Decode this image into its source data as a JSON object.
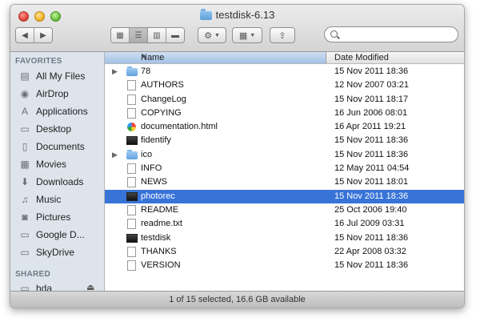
{
  "window": {
    "title": "testdisk-6.13",
    "title_icon": "folder-icon"
  },
  "toolbar": {
    "nav": [
      "back-arrow-icon",
      "forward-arrow-icon"
    ],
    "view_modes": [
      "icon-view-icon",
      "list-view-icon",
      "column-view-icon",
      "cover-flow-icon"
    ],
    "active_view": 1,
    "action": "gear-icon",
    "arrange": "arrange-grid-icon",
    "share": "share-icon",
    "search": {
      "placeholder": ""
    }
  },
  "sidebar": {
    "favorites_header": "FAVORITES",
    "favorites": [
      {
        "label": "All My Files",
        "icon": "all-files-icon",
        "glyph": "▤"
      },
      {
        "label": "AirDrop",
        "icon": "airdrop-icon",
        "glyph": "◉"
      },
      {
        "label": "Applications",
        "icon": "applications-icon",
        "glyph": "A"
      },
      {
        "label": "Desktop",
        "icon": "desktop-icon",
        "glyph": "▭"
      },
      {
        "label": "Documents",
        "icon": "documents-icon",
        "glyph": "▯"
      },
      {
        "label": "Movies",
        "icon": "movies-icon",
        "glyph": "▦"
      },
      {
        "label": "Downloads",
        "icon": "downloads-icon",
        "glyph": "⬇"
      },
      {
        "label": "Music",
        "icon": "music-icon",
        "glyph": "♫"
      },
      {
        "label": "Pictures",
        "icon": "pictures-icon",
        "glyph": "◙"
      },
      {
        "label": "Google D...",
        "icon": "google-drive-folder-icon",
        "glyph": "▭"
      },
      {
        "label": "SkyDrive",
        "icon": "skydrive-folder-icon",
        "glyph": "▭"
      }
    ],
    "shared_header": "SHARED",
    "shared": [
      {
        "label": "hda",
        "icon": "shared-computer-icon",
        "glyph": "▭"
      }
    ]
  },
  "columns": {
    "name": "Name",
    "date_modified": "Date Modified"
  },
  "files": [
    {
      "name": "78",
      "date": "15 Nov 2011 18:36",
      "type": "folder",
      "expandable": true
    },
    {
      "name": "AUTHORS",
      "date": "12 Nov 2007 03:21",
      "type": "doc"
    },
    {
      "name": "ChangeLog",
      "date": "15 Nov 2011 18:17",
      "type": "doc"
    },
    {
      "name": "COPYING",
      "date": "16 Jun 2006 08:01",
      "type": "doc"
    },
    {
      "name": "documentation.html",
      "date": "16 Apr 2011 19:21",
      "type": "html"
    },
    {
      "name": "fidentify",
      "date": "15 Nov 2011 18:36",
      "type": "exec"
    },
    {
      "name": "ico",
      "date": "15 Nov 2011 18:36",
      "type": "folder",
      "expandable": true
    },
    {
      "name": "INFO",
      "date": "12 May 2011 04:54",
      "type": "doc"
    },
    {
      "name": "NEWS",
      "date": "15 Nov 2011 18:01",
      "type": "doc"
    },
    {
      "name": "photorec",
      "date": "15 Nov 2011 18:36",
      "type": "exec",
      "selected": true
    },
    {
      "name": "README",
      "date": "25 Oct 2006 19:40",
      "type": "doc"
    },
    {
      "name": "readme.txt",
      "date": "16 Jul 2009 03:31",
      "type": "doc"
    },
    {
      "name": "testdisk",
      "date": "15 Nov 2011 18:36",
      "type": "exec"
    },
    {
      "name": "THANKS",
      "date": "22 Apr 2008 03:32",
      "type": "doc"
    },
    {
      "name": "VERSION",
      "date": "15 Nov 2011 18:36",
      "type": "doc"
    }
  ],
  "status": "1 of 15 selected, 16.6 GB available",
  "colors": {
    "selection": "#3874d8",
    "sidebar": "#dde4eb",
    "column_header_active": "#a4c1e6"
  }
}
